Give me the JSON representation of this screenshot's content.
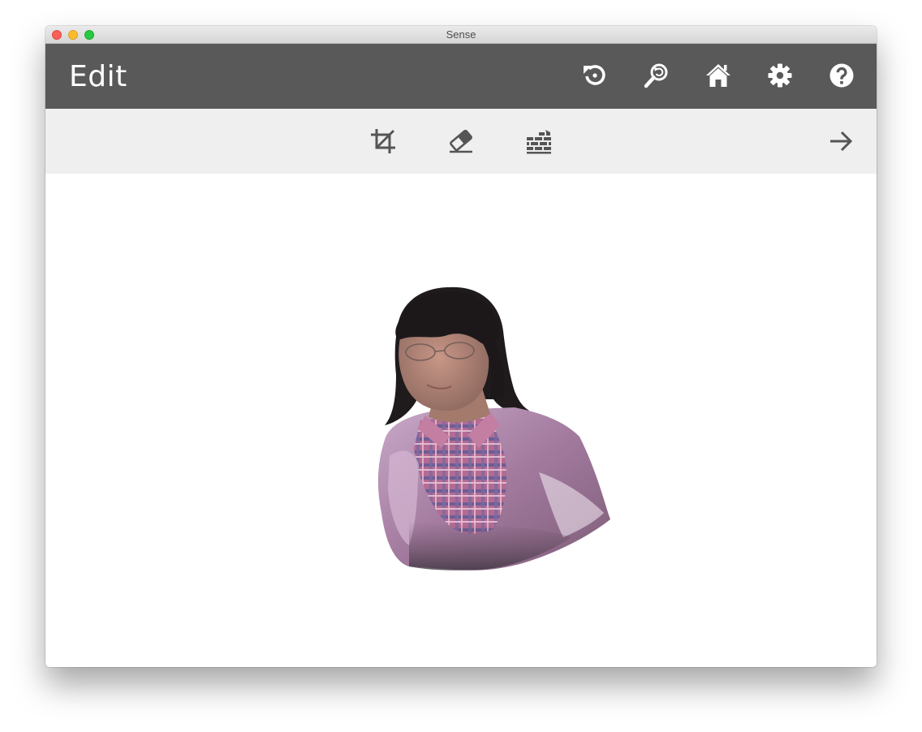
{
  "window": {
    "title": "Sense"
  },
  "appbar": {
    "title": "Edit",
    "icons": {
      "reset": "reset-icon",
      "zoom_reset": "zoom-reset-icon",
      "home": "home-icon",
      "settings": "gear-icon",
      "help": "help-icon"
    }
  },
  "toolbar": {
    "icons": {
      "crop": "crop-icon",
      "erase": "eraser-icon",
      "solidify": "brick-wall-icon",
      "next": "arrow-right-icon"
    }
  },
  "canvas": {
    "content": "3d-scan-model"
  },
  "colors": {
    "appbar": "#595959",
    "toolbar": "#efefef",
    "icon_light": "#ffffff",
    "icon_dark": "#555555",
    "canvas": "#ffffff"
  }
}
